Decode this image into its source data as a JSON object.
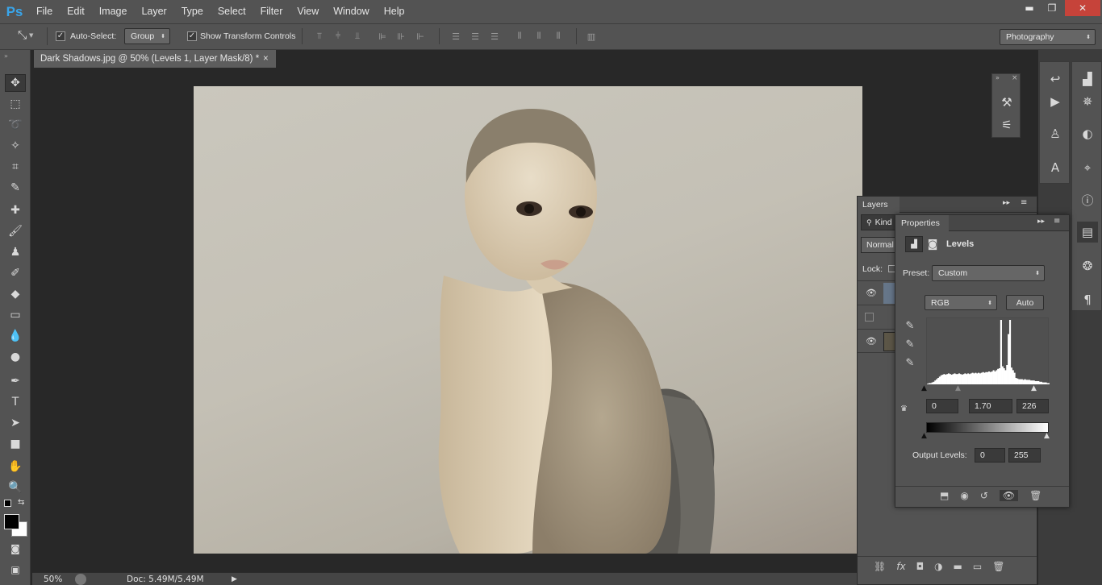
{
  "app": {
    "logo": "Ps"
  },
  "menu": [
    "File",
    "Edit",
    "Image",
    "Layer",
    "Type",
    "Select",
    "Filter",
    "View",
    "Window",
    "Help"
  ],
  "window_controls": {
    "minimize": "▬",
    "restore": "❐",
    "close": "✕"
  },
  "options_bar": {
    "auto_select_label": "Auto-Select:",
    "auto_select_checked": true,
    "auto_select_target": "Group",
    "show_transform_label": "Show Transform Controls",
    "show_transform_checked": true,
    "workspace": "Photography"
  },
  "document": {
    "tab_title": "Dark Shadows.jpg @ 50% (Levels 1, Layer Mask/8) *",
    "close_glyph": "×"
  },
  "status": {
    "zoom": "50%",
    "doc_info": "Doc: 5.49M/5.49M"
  },
  "layers_panel": {
    "title": "Layers",
    "filter_kind": "Kind",
    "blend_mode": "Normal",
    "lock_label": "Lock:",
    "rows": [
      {
        "visible": true,
        "selected": true
      },
      {
        "visible": false,
        "selected": false
      },
      {
        "visible": true,
        "selected": false
      }
    ],
    "footer_icons": [
      "link-icon",
      "fx-icon",
      "mask-icon",
      "adjustment-icon",
      "group-icon",
      "new-layer-icon",
      "trash-icon"
    ],
    "fx_label": "fx"
  },
  "properties_panel": {
    "title": "Properties",
    "adjustment_name": "Levels",
    "preset_label": "Preset:",
    "preset_value": "Custom",
    "channel": "RGB",
    "auto_button": "Auto",
    "input_black": "0",
    "input_gamma": "1.70",
    "input_white": "226",
    "output_label": "Output Levels:",
    "output_black": "0",
    "output_white": "255",
    "histogram": [
      1,
      2,
      2,
      3,
      4,
      6,
      8,
      10,
      12,
      14,
      15,
      16,
      15,
      16,
      17,
      16,
      15,
      16,
      17,
      16,
      16,
      17,
      16,
      15,
      16,
      17,
      16,
      17,
      16,
      17,
      18,
      17,
      18,
      17,
      18,
      17,
      18,
      19,
      18,
      19,
      19,
      20,
      19,
      20,
      22,
      20,
      22,
      24,
      25,
      100,
      28,
      25,
      22,
      30,
      78,
      100,
      26,
      22,
      18,
      10,
      9,
      8,
      8,
      8,
      7,
      8,
      7,
      7,
      7,
      6,
      6,
      6,
      5,
      5,
      5,
      4,
      4,
      3,
      3,
      3,
      2,
      2
    ]
  },
  "colors": {
    "accent": "#39a5ea",
    "panel": "#535353",
    "canvas_bg": "#282828"
  }
}
